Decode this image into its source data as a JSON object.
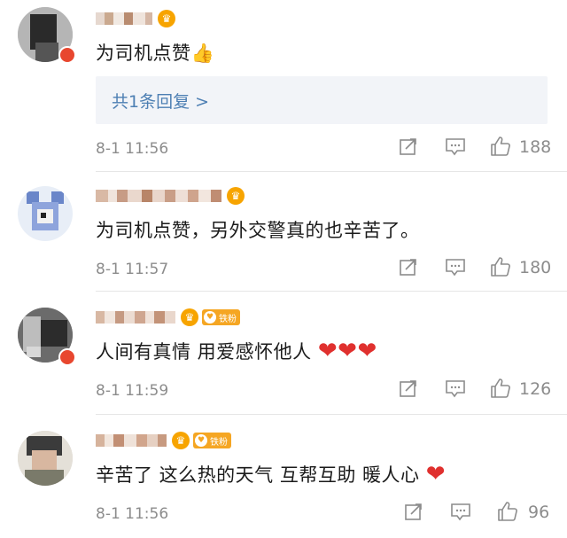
{
  "comments": [
    {
      "text": "为司机点赞👍",
      "badge": "crown",
      "replies_label": "共1条回复 >",
      "time": "8-1 11:56",
      "likes": "188"
    },
    {
      "text": "为司机点赞，另外交警真的也辛苦了。",
      "badge": "crown",
      "time": "8-1 11:57",
      "likes": "180"
    },
    {
      "text": "人间有真情 用爱感怀他人 ❤️❤️❤️",
      "badge": "crown",
      "fan_label": "铁粉",
      "time": "8-1 11:59",
      "likes": "126"
    },
    {
      "text": "辛苦了  这么热的天气  互帮互助  暖人心  ❤️",
      "badge": "crown",
      "fan_label": "铁粉",
      "time": "8-1 11:56",
      "likes": "96"
    }
  ],
  "icons": {
    "share": "share-icon",
    "comment": "comment-icon",
    "like": "thumbs-up-icon",
    "crown": "crown-badge-icon"
  },
  "colors": {
    "reply_link": "#4d7fb3",
    "meta_gray": "#8c8c8c",
    "heart_red": "#e0302e",
    "badge_gold": "#f5a623",
    "reply_bg": "#f2f4f8"
  }
}
